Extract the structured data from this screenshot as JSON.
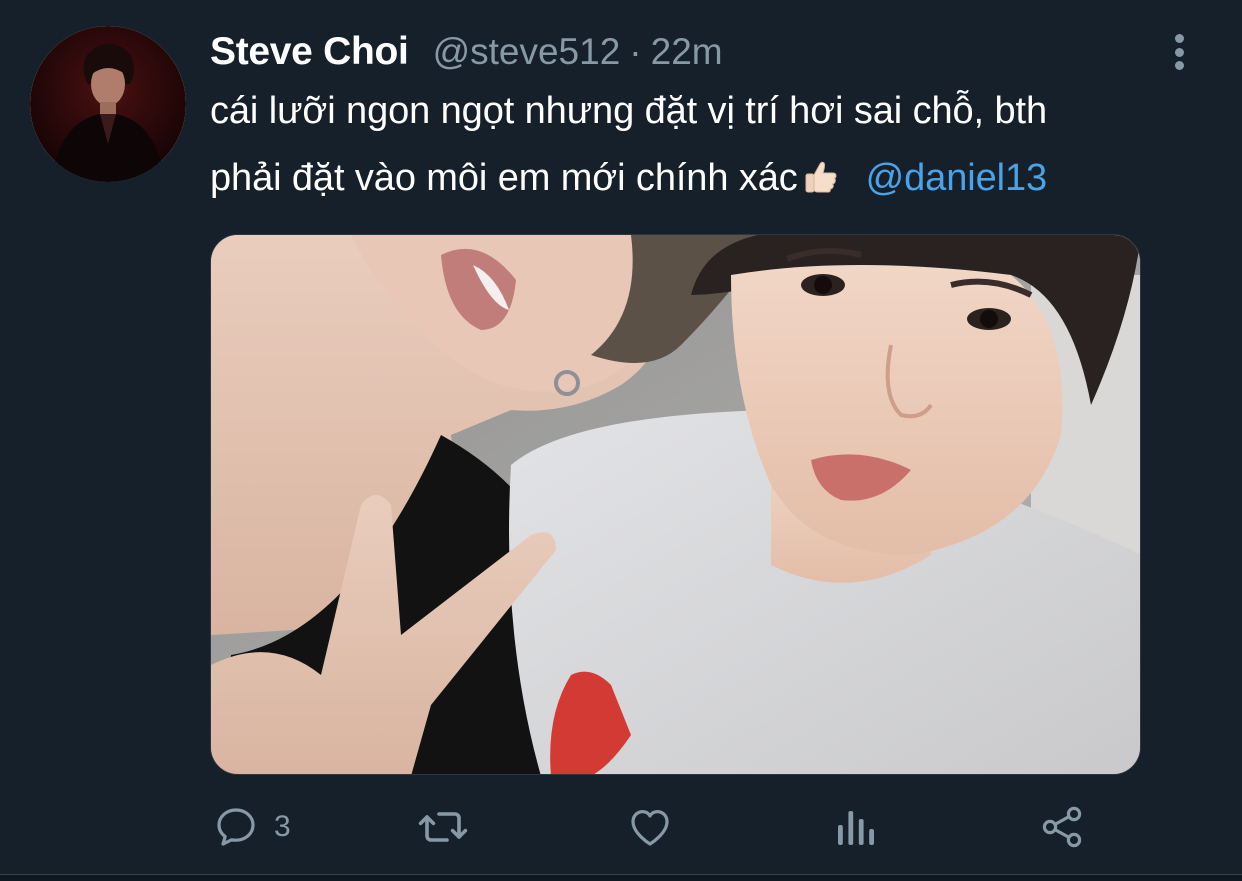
{
  "tweet": {
    "author": {
      "display_name": "Steve Choi",
      "handle": "@steve512",
      "separator": "·",
      "time": "22m",
      "avatar_icon": "profile-photo"
    },
    "text": {
      "line1": "cái lưỡi ngon ngọt nhưng đặt vị trí hơi sai chỗ, bth",
      "line2": "phải đặt vào môi em mới chính xác",
      "emoji": "thumbs-up-light-skin-tone",
      "mention": "@daniel13"
    },
    "media": {
      "type": "photo"
    },
    "actions": {
      "reply": {
        "icon": "reply-icon",
        "count": "3"
      },
      "retweet": {
        "icon": "retweet-icon",
        "count": ""
      },
      "like": {
        "icon": "heart-icon",
        "count": ""
      },
      "analytics": {
        "icon": "analytics-icon"
      },
      "share": {
        "icon": "share-icon"
      }
    }
  },
  "colors": {
    "background": "#15202b",
    "primary_text": "#ffffff",
    "secondary_text": "#8899a6",
    "link": "#4aa3e8"
  }
}
